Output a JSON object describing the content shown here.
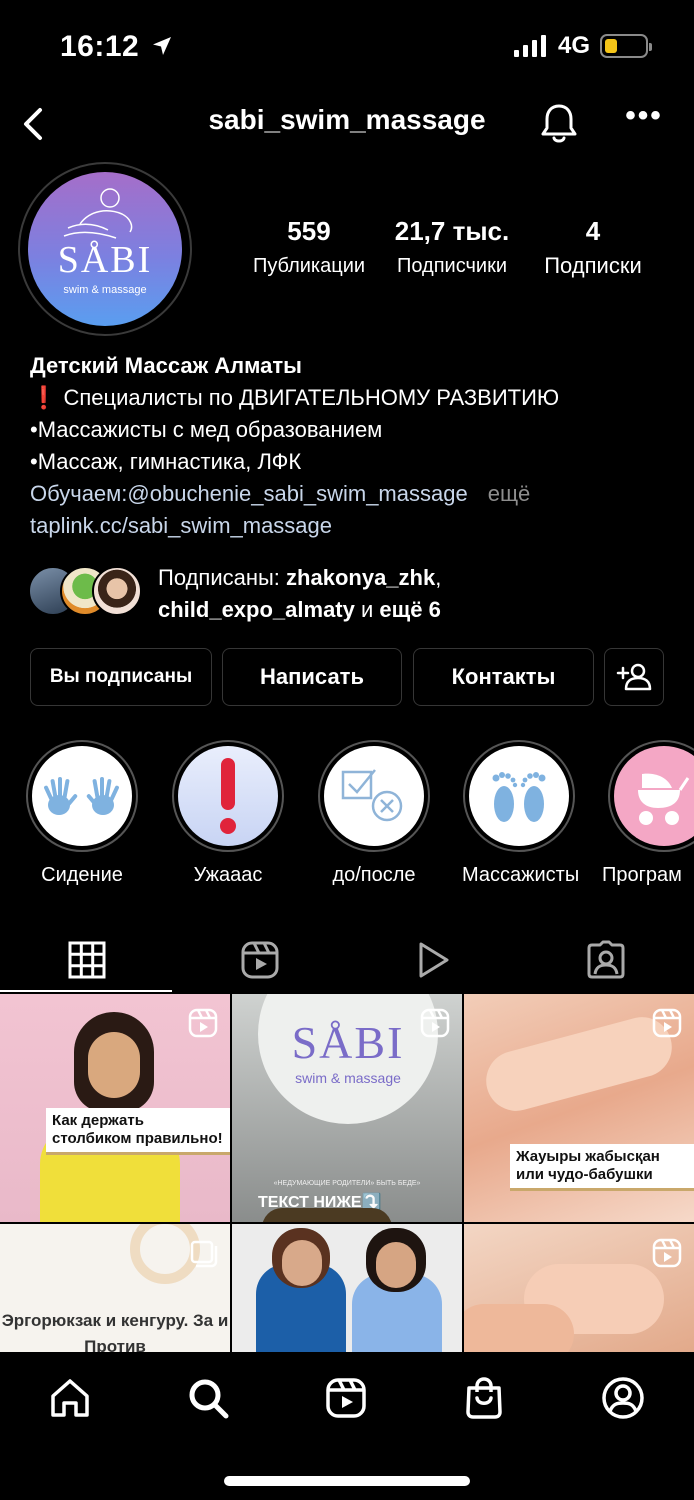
{
  "status_bar": {
    "time": "16:12",
    "network": "4G"
  },
  "header": {
    "username": "sabi_swim_massage"
  },
  "avatar": {
    "logo_text": "SÅBI",
    "logo_sub": "swim & massage"
  },
  "stats": [
    {
      "value": "559",
      "label": "Публикации"
    },
    {
      "value": "21,7 тыс.",
      "label": "Подписчики"
    },
    {
      "value": "4",
      "label": "Подписки"
    }
  ],
  "bio": {
    "name": "Детский Массаж Алматы",
    "lines": [
      "❗ Специалисты по ДВИГАТЕЛЬНОМУ РАЗВИТИЮ",
      "•Массажисты с мед образованием",
      "•Массаж, гимнастика, ЛФК"
    ],
    "teach_line": "Обучаем:@obuchenie_sabi_swim_massage",
    "more": "ещё",
    "link": "taplink.cc/sabi_swim_massage"
  },
  "followed_by": {
    "prefix": "Подписаны:",
    "user1": "zhakonya_zhk",
    "user2": "child_expo_almaty",
    "conj": "и",
    "rest": "ещё 6"
  },
  "actions": {
    "following": "Вы подписаны",
    "message": "Написать",
    "contacts": "Контакты"
  },
  "highlights": [
    {
      "label": "Сидение",
      "icon": "hands-icon"
    },
    {
      "label": "Ужааас",
      "icon": "exclamation-icon"
    },
    {
      "label": "до/после",
      "icon": "checkbox-icon"
    },
    {
      "label": "Массажисты",
      "icon": "feet-icon"
    },
    {
      "label": "Програм",
      "icon": "stroller-icon"
    }
  ],
  "tabs": [
    "grid",
    "reels",
    "video",
    "tagged"
  ],
  "grid": {
    "tile1_caption": "Как держать столбиком правильно!",
    "tile2_logo": "SÅBI",
    "tile2_logo_sub": "swim & massage",
    "tile2_small": "«НЕДУМАЮЩИЕ РОДИТЕЛИ» БЫТЬ БЕДЕ»",
    "tile2_caption": "ТЕКСТ НИЖЕ⤵️",
    "tile3_caption": "Жауыры жабысқан или чудо-бабушки",
    "tile4_caption": "Эргорюкзак и кенгуру. За и Против"
  },
  "colors": {
    "background": "#000000",
    "border": "#363636",
    "link": "#c8d6ea",
    "muted": "#8e8e8e",
    "battery": "#f5c518",
    "exclamation": "#e0243b",
    "highlight_blue": "#7fb2e0",
    "highlight_pink": "#f4a7c5"
  }
}
